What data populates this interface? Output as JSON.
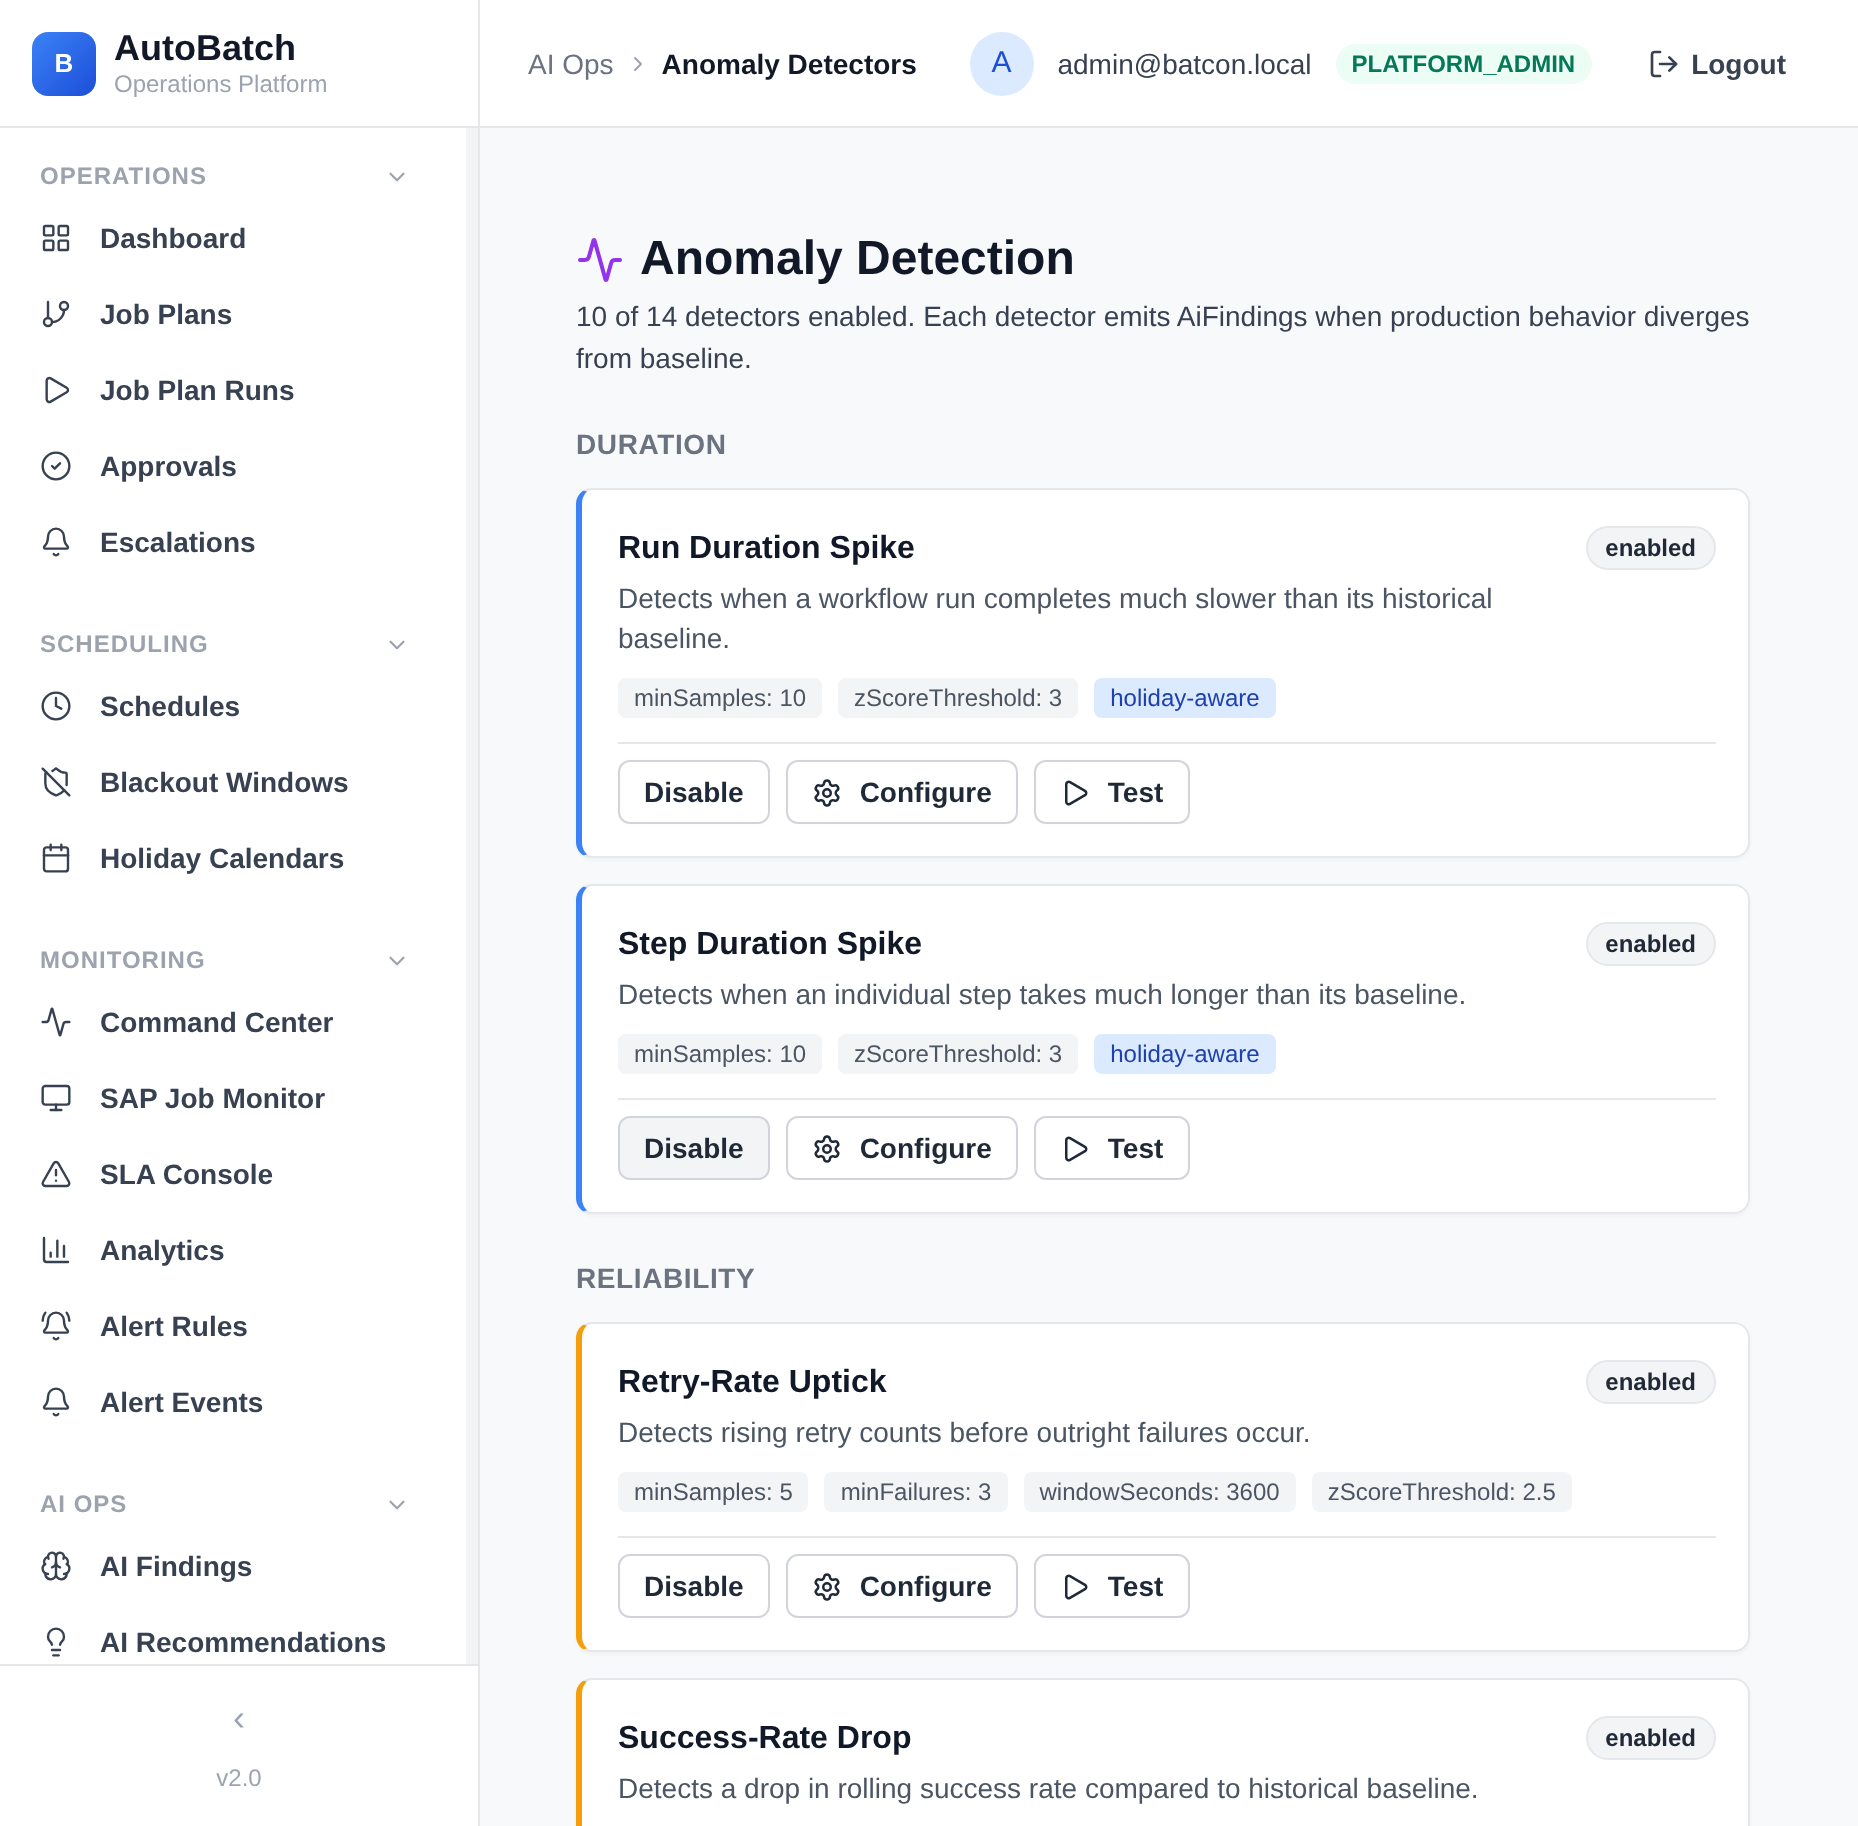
{
  "brand": {
    "logo_letter": "B",
    "name": "AutoBatch",
    "subtitle": "Operations Platform"
  },
  "sidebar": {
    "sections": [
      {
        "title": "OPERATIONS",
        "expanded": true,
        "items": [
          {
            "label": "Dashboard",
            "selected": false
          },
          {
            "label": "Job Plans",
            "selected": false
          },
          {
            "label": "Job Plan Runs",
            "selected": false
          },
          {
            "label": "Approvals",
            "selected": false
          },
          {
            "label": "Escalations",
            "selected": false
          }
        ]
      },
      {
        "title": "SCHEDULING",
        "expanded": true,
        "items": [
          {
            "label": "Schedules",
            "selected": false
          },
          {
            "label": "Blackout Windows",
            "selected": false
          },
          {
            "label": "Holiday Calendars",
            "selected": false
          }
        ]
      },
      {
        "title": "MONITORING",
        "expanded": true,
        "items": [
          {
            "label": "Command Center",
            "selected": false
          },
          {
            "label": "SAP Job Monitor",
            "selected": false
          },
          {
            "label": "SLA Console",
            "selected": false
          },
          {
            "label": "Analytics",
            "selected": false
          },
          {
            "label": "Alert Rules",
            "selected": false
          },
          {
            "label": "Alert Events",
            "selected": false
          }
        ]
      },
      {
        "title": "AI OPS",
        "expanded": true,
        "items": [
          {
            "label": "AI Findings",
            "selected": false
          },
          {
            "label": "AI Recommendations",
            "selected": false
          }
        ]
      }
    ],
    "collapse": "‹",
    "version": "v2.0"
  },
  "header": {
    "breadcrumb": [
      "AI Ops",
      "Anomaly Detectors"
    ],
    "user": {
      "avatar": "A",
      "email": "admin@batcon.local",
      "role": "PLATFORM_ADMIN"
    },
    "logout": "Logout"
  },
  "page": {
    "title": "Anomaly Detection",
    "summary": "10 of 14 detectors enabled. Each detector emits AiFindings when production behavior diverges from baseline.",
    "groups": [
      {
        "title": "DURATION",
        "color": "#3b82f6",
        "detectors": [
          {
            "name": "Run Duration Spike",
            "status": "enabled",
            "description": "Detects when a workflow run completes much slower than its historical baseline.",
            "tags": [
              {
                "kind": "param",
                "text": "minSamples: 10"
              },
              {
                "kind": "param",
                "text": "zScoreThreshold: 3"
              },
              {
                "kind": "flag",
                "text": "holiday-aware"
              }
            ],
            "actions": [
              {
                "kind": "toggle",
                "label": "Disable",
                "hovered": false
              },
              {
                "kind": "configure",
                "label": "Configure",
                "hovered": false
              },
              {
                "kind": "test",
                "label": "Test",
                "hovered": false
              }
            ]
          },
          {
            "name": "Step Duration Spike",
            "status": "enabled",
            "description": "Detects when an individual step takes much longer than its baseline.",
            "tags": [
              {
                "kind": "param",
                "text": "minSamples: 10"
              },
              {
                "kind": "param",
                "text": "zScoreThreshold: 3"
              },
              {
                "kind": "flag",
                "text": "holiday-aware"
              }
            ],
            "actions": [
              {
                "kind": "toggle",
                "label": "Disable",
                "hovered": true
              },
              {
                "kind": "configure",
                "label": "Configure",
                "hovered": false
              },
              {
                "kind": "test",
                "label": "Test",
                "hovered": false
              }
            ]
          }
        ]
      },
      {
        "title": "RELIABILITY",
        "color": "#f59e0b",
        "detectors": [
          {
            "name": "Retry-Rate Uptick",
            "status": "enabled",
            "description": "Detects rising retry counts before outright failures occur.",
            "tags": [
              {
                "kind": "param",
                "text": "minSamples: 5"
              },
              {
                "kind": "param",
                "text": "minFailures: 3"
              },
              {
                "kind": "param",
                "text": "windowSeconds: 3600"
              },
              {
                "kind": "param",
                "text": "zScoreThreshold: 2.5"
              }
            ],
            "actions": [
              {
                "kind": "toggle",
                "label": "Disable",
                "hovered": false
              },
              {
                "kind": "configure",
                "label": "Configure",
                "hovered": false
              },
              {
                "kind": "test",
                "label": "Test",
                "hovered": false
              }
            ]
          },
          {
            "name": "Success-Rate Drop",
            "status": "enabled",
            "description": "Detects a drop in rolling success rate compared to historical baseline."
          }
        ]
      }
    ]
  }
}
